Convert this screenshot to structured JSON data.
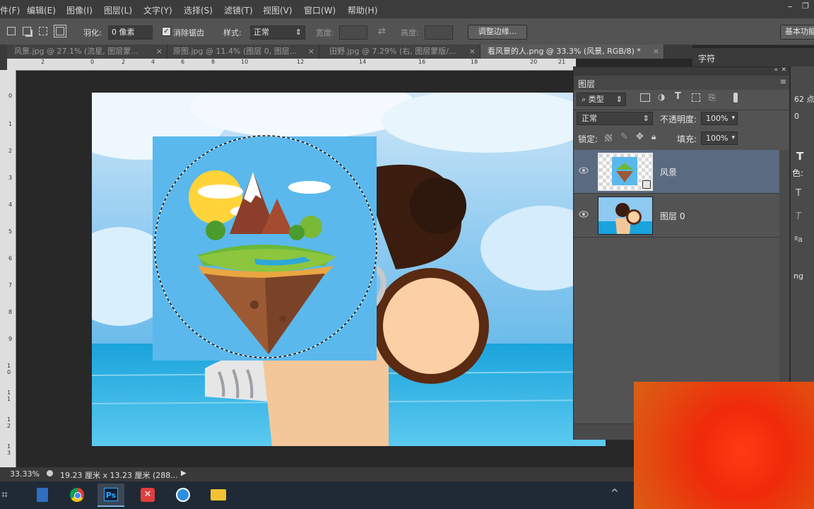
{
  "menubar": {
    "items": [
      "件(F)",
      "编辑(E)",
      "图像(I)",
      "图层(L)",
      "文字(Y)",
      "选择(S)",
      "滤镜(T)",
      "视图(V)",
      "窗口(W)",
      "帮助(H)"
    ],
    "window_buttons": [
      "–",
      "❐",
      "✕"
    ]
  },
  "options": {
    "feather_label": "羽化:",
    "feather_value": "0 像素",
    "antialias_label": "消除锯齿",
    "style_label": "样式:",
    "style_value": "正常",
    "width_label": "宽度:",
    "height_label": "高度:",
    "refine_edge": "调整边缘...",
    "workspace": "基本功能"
  },
  "tabs": [
    {
      "label": "风景.jpg @ 27.1% (流星, 图层蒙...",
      "close": "×"
    },
    {
      "label": "原图.jpg @ 11.4% (图层 0, 图层...",
      "close": "×"
    },
    {
      "label": "田野.jpg @ 7.29% (右, 图层蒙版/...",
      "close": "×"
    },
    {
      "label": "看风景的人.png @ 33.3% (风景, RGB/8) *",
      "close": "×"
    }
  ],
  "ruler": {
    "h_ticks": [
      "2",
      "0",
      "2",
      "4",
      "6",
      "8",
      "10",
      "12",
      "14",
      "16",
      "18",
      "20",
      "21"
    ],
    "v_ticks": [
      "0",
      "1",
      "2",
      "3",
      "4",
      "5",
      "6",
      "7",
      "8",
      "9",
      "1 0",
      "1 1",
      "1 2",
      "1 3"
    ]
  },
  "layers_panel": {
    "title": "图层",
    "filter_label": "类型",
    "blend_mode": "正常",
    "opacity_label": "不透明度:",
    "opacity_value": "100%",
    "lock_label": "锁定:",
    "fill_label": "填充:",
    "fill_value": "100%",
    "layers": [
      {
        "name": "风景",
        "selected": true
      },
      {
        "name": "图层 0",
        "selected": false
      }
    ]
  },
  "char_panel": {
    "title": "字符",
    "size_value": "62 点",
    "tracking_value": "0",
    "color_label": "色:",
    "extra_label": "ng"
  },
  "status": {
    "zoom": "33.33%",
    "doc_size": "19.23 厘米 x 13.23 厘米 (288..."
  },
  "taskbar": {
    "apps": [
      "apps-icon",
      "calculator-icon",
      "chrome-icon",
      "photoshop-icon",
      "xmind-icon",
      "browser-icon",
      "file-explorer-icon"
    ]
  },
  "colors": {
    "accent": "#7fb0e0",
    "panel": "#535353",
    "selected_layer": "#5a6a80"
  }
}
